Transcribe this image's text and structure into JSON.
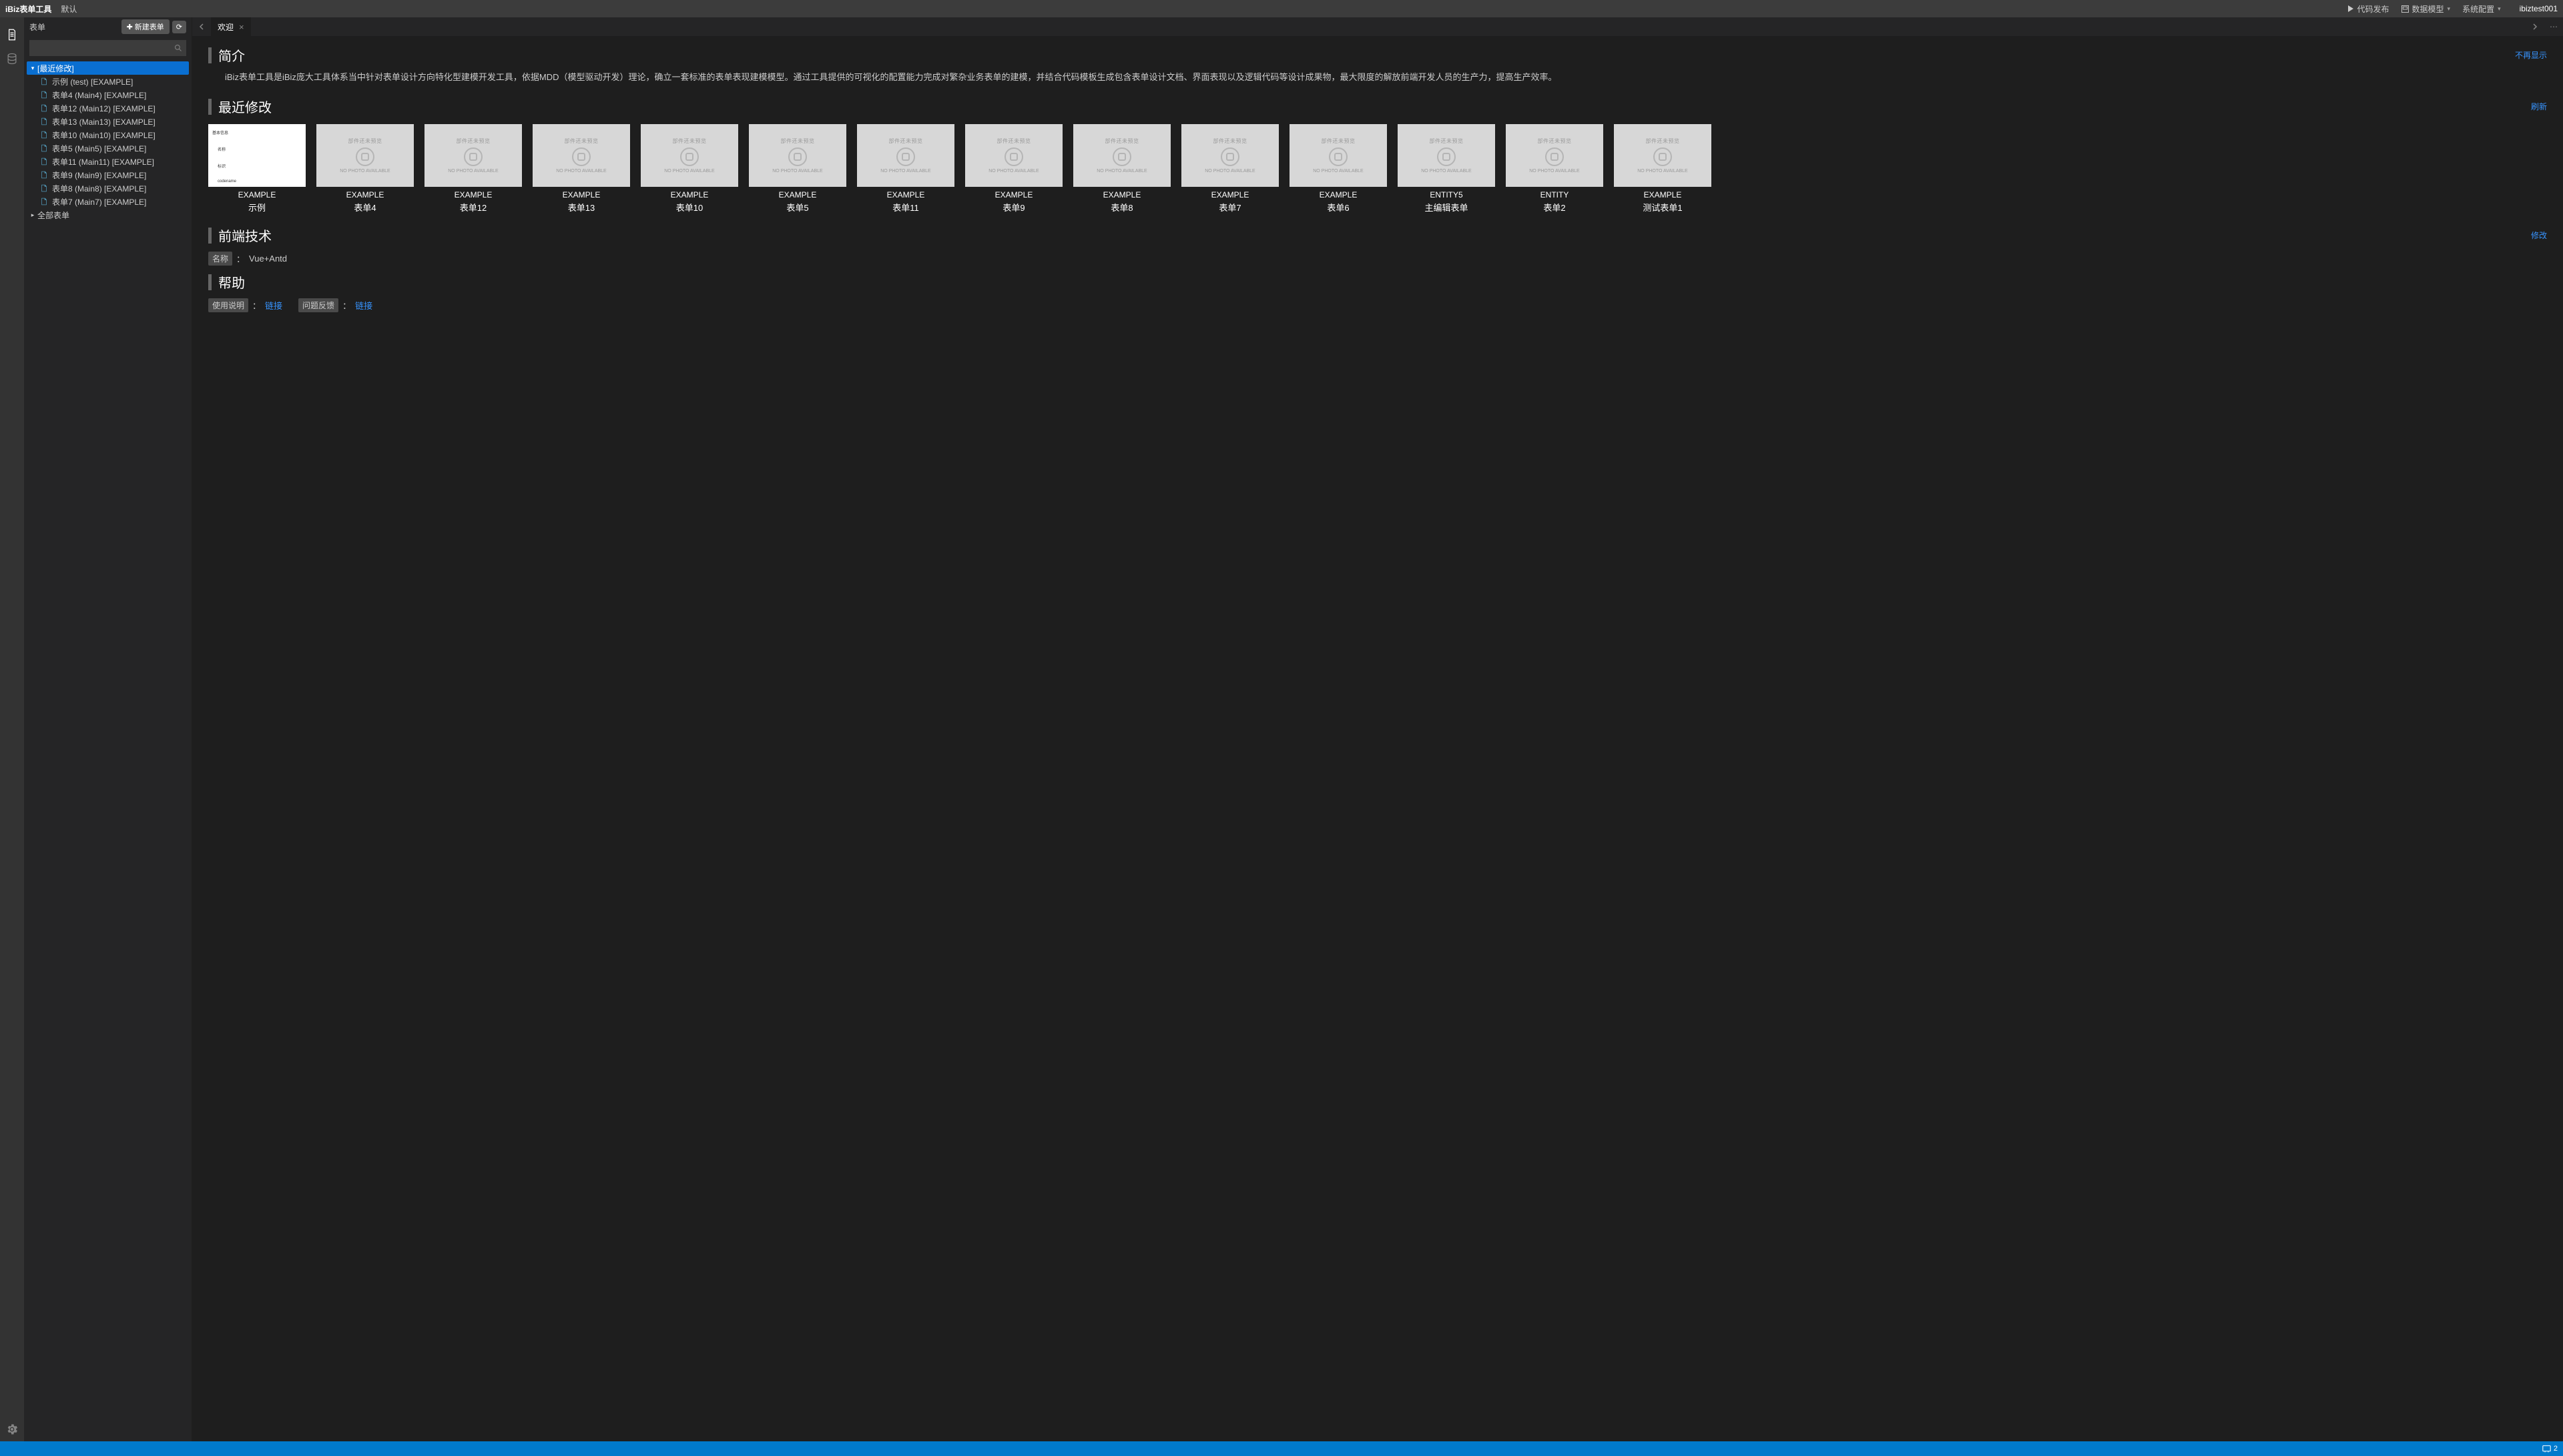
{
  "menubar": {
    "brand": "iBiz表单工具",
    "default": "默认",
    "publish": "代码发布",
    "datamodel": "数据模型",
    "sysconfig": "系统配置",
    "user": "ibiztest001"
  },
  "sidebar": {
    "title": "表单",
    "new_btn": "新建表单",
    "search_placeholder": "",
    "tree": {
      "recent_label": "[最近修改]",
      "all_label": "全部表单",
      "items": [
        "示例 (test) [EXAMPLE]",
        "表单4 (Main4) [EXAMPLE]",
        "表单12 (Main12) [EXAMPLE]",
        "表单13 (Main13) [EXAMPLE]",
        "表单10 (Main10) [EXAMPLE]",
        "表单5 (Main5) [EXAMPLE]",
        "表单11 (Main11) [EXAMPLE]",
        "表单9 (Main9) [EXAMPLE]",
        "表单8 (Main8) [EXAMPLE]",
        "表单7 (Main7) [EXAMPLE]"
      ]
    }
  },
  "tabs": {
    "welcome": "欢迎"
  },
  "content": {
    "intro_title": "简介",
    "intro_hide": "不再显示",
    "intro_body": "iBiz表单工具是iBiz庞大工具体系当中针对表单设计方向特化型建模开发工具，依据MDD（模型驱动开发）理论，确立一套标准的表单表现建模模型。通过工具提供的可视化的配置能力完成对繁杂业务表单的建模，并结合代码模板生成包含表单设计文档、界面表现以及逻辑代码等设计成果物，最大限度的解放前端开发人员的生产力，提高生产效率。",
    "recent_title": "最近修改",
    "recent_refresh": "刷新",
    "placeholder_top": "部件还未预览",
    "placeholder_mid": "NO PHOTO\nAVAILABLE",
    "cards": [
      {
        "l1": "EXAMPLE",
        "l2": "示例",
        "preview": true
      },
      {
        "l1": "EXAMPLE",
        "l2": "表单4"
      },
      {
        "l1": "EXAMPLE",
        "l2": "表单12"
      },
      {
        "l1": "EXAMPLE",
        "l2": "表单13"
      },
      {
        "l1": "EXAMPLE",
        "l2": "表单10"
      },
      {
        "l1": "EXAMPLE",
        "l2": "表单5"
      },
      {
        "l1": "EXAMPLE",
        "l2": "表单11"
      },
      {
        "l1": "EXAMPLE",
        "l2": "表单9"
      },
      {
        "l1": "EXAMPLE",
        "l2": "表单8"
      },
      {
        "l1": "EXAMPLE",
        "l2": "表单7"
      },
      {
        "l1": "EXAMPLE",
        "l2": "表单6"
      },
      {
        "l1": "ENTITY5",
        "l2": "主编辑表单"
      },
      {
        "l1": "ENTITY",
        "l2": "表单2"
      },
      {
        "l1": "EXAMPLE",
        "l2": "测试表单1"
      }
    ],
    "frontend_title": "前端技术",
    "frontend_edit": "修改",
    "frontend_name_label": "名称",
    "frontend_name_value": "Vue+Antd",
    "help_title": "帮助",
    "help_usage_label": "使用说明",
    "help_usage_link": "链接",
    "help_feedback_label": "问题反馈",
    "help_feedback_link": "链接"
  },
  "statusbar": {
    "count": "2"
  }
}
